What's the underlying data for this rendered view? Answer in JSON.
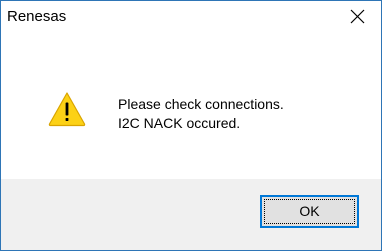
{
  "dialog": {
    "title": "Renesas",
    "close_icon": "close-icon",
    "icon": "warning-icon",
    "message_line1": "Please check connections.",
    "message_line2": "I2C NACK occured.",
    "ok_label": "OK",
    "accent_color": "#0078d7",
    "warning_color": "#fcd116"
  }
}
